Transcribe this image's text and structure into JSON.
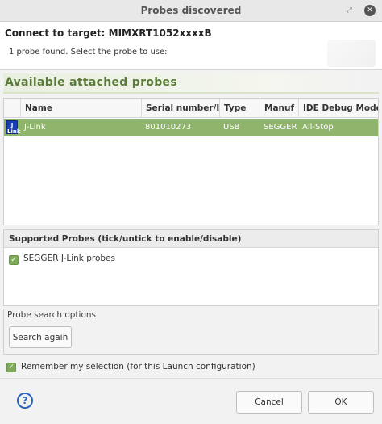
{
  "window": {
    "title": "Probes discovered"
  },
  "header": {
    "title": "Connect to target: MIMXRT1052xxxxB",
    "message": "1 probe found. Select the probe to use:"
  },
  "section": {
    "title": "Available attached probes"
  },
  "table": {
    "columns": [
      "Name",
      "Serial number/I",
      "Type",
      "Manuf",
      "IDE Debug Mode"
    ],
    "rows": [
      {
        "icon_text": "J\nLink",
        "name": "J-Link",
        "serial": "801010273",
        "type": "USB",
        "manufacturer": "SEGGER",
        "mode": "All-Stop"
      }
    ]
  },
  "supported": {
    "title": "Supported Probes (tick/untick to enable/disable)",
    "items": [
      {
        "label": "SEGGER J-Link probes",
        "checked": true
      }
    ]
  },
  "search": {
    "legend": "Probe search options",
    "button": "Search again"
  },
  "remember": {
    "label": "Remember my selection (for this Launch configuration)",
    "checked": true
  },
  "buttons": {
    "cancel": "Cancel",
    "ok": "OK",
    "help": "?"
  },
  "colors": {
    "selection": "#8fb46c",
    "accent_green": "#7ea85a",
    "heading_green": "#5a7a3a",
    "help_blue": "#2a66b5"
  }
}
